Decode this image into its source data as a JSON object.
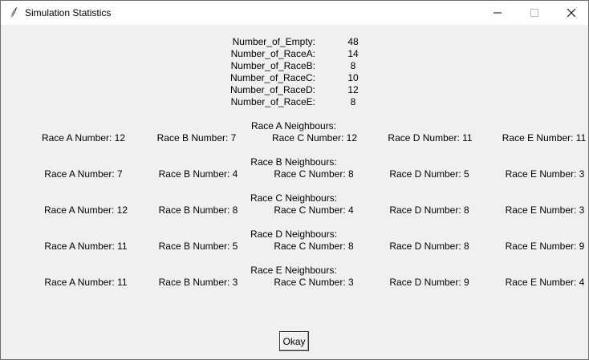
{
  "window": {
    "title": "Simulation Statistics",
    "icon": "feather-icon",
    "controls": [
      "minimize-icon",
      "maximize-icon",
      "close-icon"
    ]
  },
  "stats": [
    {
      "label": "Number_of_Empty:",
      "value": "48"
    },
    {
      "label": "Number_of_RaceA:",
      "value": "14"
    },
    {
      "label": "Number_of_RaceB:",
      "value": "8"
    },
    {
      "label": "Number_of_RaceC:",
      "value": "10"
    },
    {
      "label": "Number_of_RaceD:",
      "value": "12"
    },
    {
      "label": "Number_of_RaceE:",
      "value": "8"
    }
  ],
  "neighbours": [
    {
      "title": "Race A Neighbours:",
      "cells": [
        "Race A Number: 12",
        "Race B Number: 7",
        "Race C Number: 12",
        "Race D Number: 11",
        "Race E Number: 11"
      ]
    },
    {
      "title": "Race B Neighbours:",
      "cells": [
        "Race A Number: 7",
        "Race B Number: 4",
        "Race C Number: 8",
        "Race D Number: 5",
        "Race E Number: 3"
      ]
    },
    {
      "title": "Race C Neighbours:",
      "cells": [
        "Race A Number: 12",
        "Race B Number: 8",
        "Race C Number: 4",
        "Race D Number: 8",
        "Race E Number: 3"
      ]
    },
    {
      "title": "Race D Neighbours:",
      "cells": [
        "Race A Number: 11",
        "Race B Number: 5",
        "Race C Number: 8",
        "Race D Number: 8",
        "Race E Number: 9"
      ]
    },
    {
      "title": "Race E Neighbours:",
      "cells": [
        "Race A Number: 11",
        "Race B Number: 3",
        "Race C Number: 3",
        "Race D Number: 9",
        "Race E Number: 4"
      ]
    }
  ],
  "okay_label": "Okay"
}
